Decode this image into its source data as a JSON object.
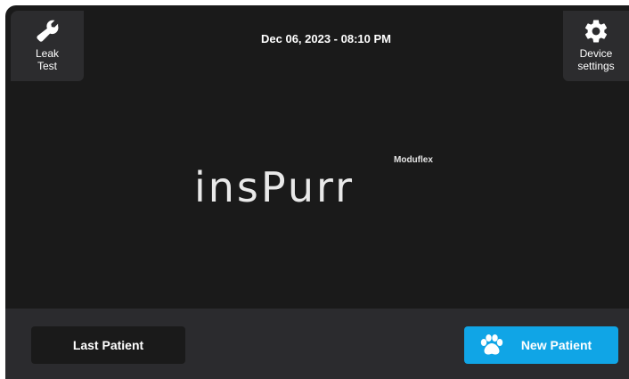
{
  "header": {
    "datetime": "Dec 06, 2023 - 08:10 PM",
    "leak_test_label": "Leak\nTest",
    "device_settings_label": "Device\nsettings"
  },
  "brand": {
    "name": "insPurr",
    "subtitle": "Moduflex"
  },
  "footer": {
    "last_patient_label": "Last Patient",
    "new_patient_label": "New Patient"
  },
  "colors": {
    "background": "#1a1a1a",
    "panel": "#2c2c2e",
    "accent": "#10a5e6",
    "text": "#ffffff"
  },
  "icons": {
    "leak_test": "wrench-icon",
    "device_settings": "gear-icon",
    "new_patient": "paw-icon"
  }
}
